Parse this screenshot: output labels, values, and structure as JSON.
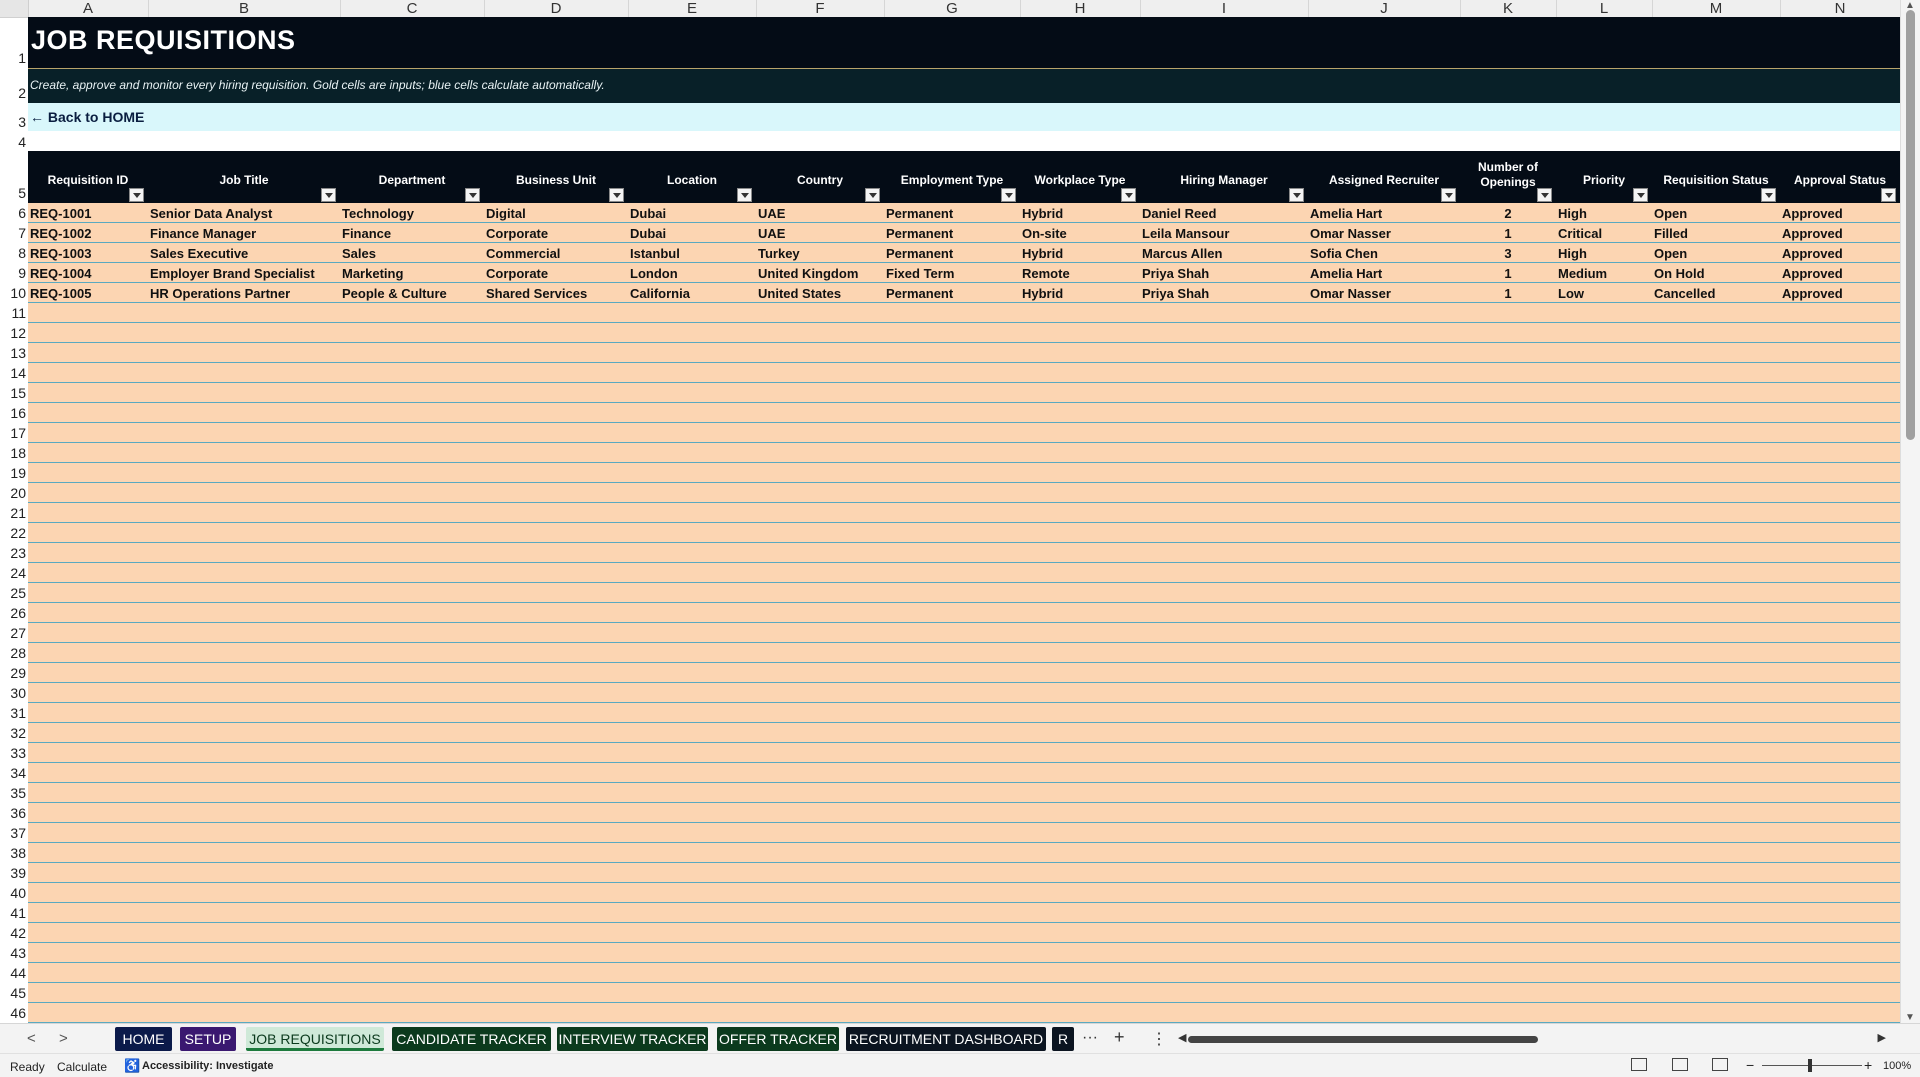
{
  "columns": [
    "A",
    "B",
    "C",
    "D",
    "E",
    "F",
    "G",
    "H",
    "I",
    "J",
    "K",
    "L",
    "M",
    "N"
  ],
  "rows": [
    "1",
    "2",
    "3",
    "4",
    "5",
    "6",
    "7",
    "8",
    "9",
    "10",
    "11",
    "12",
    "13",
    "14",
    "15",
    "16",
    "17",
    "18",
    "19",
    "20",
    "21",
    "22",
    "23",
    "24",
    "25",
    "26",
    "27",
    "28",
    "29",
    "30",
    "31",
    "32",
    "33",
    "34",
    "35",
    "36",
    "37",
    "38",
    "39",
    "40",
    "41",
    "42",
    "43",
    "44",
    "45",
    "46"
  ],
  "sheet": {
    "title": "JOB REQUISITIONS",
    "subtitle": "Create, approve and monitor every hiring requisition. Gold cells are inputs; blue cells calculate automatically.",
    "back_link": "← Back to HOME"
  },
  "table": {
    "headers": [
      "Requisition ID",
      "Job Title",
      "Department",
      "Business Unit",
      "Location",
      "Country",
      "Employment Type",
      "Workplace Type",
      "Hiring Manager",
      "Assigned Recruiter",
      "Number of Openings",
      "Priority",
      "Requisition Status",
      "Approval Status"
    ],
    "rows": [
      [
        "REQ-1001",
        "Senior Data Analyst",
        "Technology",
        "Digital",
        "Dubai",
        "UAE",
        "Permanent",
        "Hybrid",
        "Daniel Reed",
        "Amelia Hart",
        "2",
        "High",
        "Open",
        "Approved"
      ],
      [
        "REQ-1002",
        "Finance Manager",
        "Finance",
        "Corporate",
        "Dubai",
        "UAE",
        "Permanent",
        "On-site",
        "Leila Mansour",
        "Omar Nasser",
        "1",
        "Critical",
        "Filled",
        "Approved"
      ],
      [
        "REQ-1003",
        "Sales Executive",
        "Sales",
        "Commercial",
        "Istanbul",
        "Turkey",
        "Permanent",
        "Hybrid",
        "Marcus Allen",
        "Sofia Chen",
        "3",
        "High",
        "Open",
        "Approved"
      ],
      [
        "REQ-1004",
        "Employer Brand Specialist",
        "Marketing",
        "Corporate",
        "London",
        "United Kingdom",
        "Fixed Term",
        "Remote",
        "Priya Shah",
        "Amelia Hart",
        "1",
        "Medium",
        "On Hold",
        "Approved"
      ],
      [
        "REQ-1005",
        "HR Operations Partner",
        "People & Culture",
        "Shared Services",
        "California",
        "United States",
        "Permanent",
        "Hybrid",
        "Priya Shah",
        "Omar Nasser",
        "1",
        "Low",
        "Cancelled",
        "Approved"
      ]
    ]
  },
  "tabs": [
    {
      "label": "HOME",
      "style": "navy"
    },
    {
      "label": "SETUP",
      "style": "purple"
    },
    {
      "label": "JOB REQUISITIONS",
      "style": "active"
    },
    {
      "label": "CANDIDATE TRACKER",
      "style": "green"
    },
    {
      "label": "INTERVIEW TRACKER",
      "style": "green"
    },
    {
      "label": "OFFER TRACKER",
      "style": "green"
    },
    {
      "label": "RECRUITMENT DASHBOARD",
      "style": "dark"
    },
    {
      "label": "R",
      "style": "dark"
    }
  ],
  "tab_controls": {
    "prev": "<",
    "next": ">",
    "more": "···",
    "add": "+",
    "options": "⋮"
  },
  "status": {
    "ready": "Ready",
    "calculate": "Calculate",
    "accessibility": "Accessibility: Investigate",
    "zoom": "100%",
    "zoom_minus": "−",
    "zoom_plus": "+"
  },
  "colors": {
    "header_band": "#040c16",
    "subtitle_band": "#082028",
    "link_band": "#d9f7fb",
    "input_cells": "#fcd5b2",
    "row_lines": "#5aa9c0"
  },
  "icons": {
    "filter": "filter-dropdown-icon",
    "accessibility": "accessibility-icon",
    "normal_view": "normal-view-icon",
    "page_layout": "page-layout-icon",
    "page_break": "page-break-preview-icon"
  }
}
